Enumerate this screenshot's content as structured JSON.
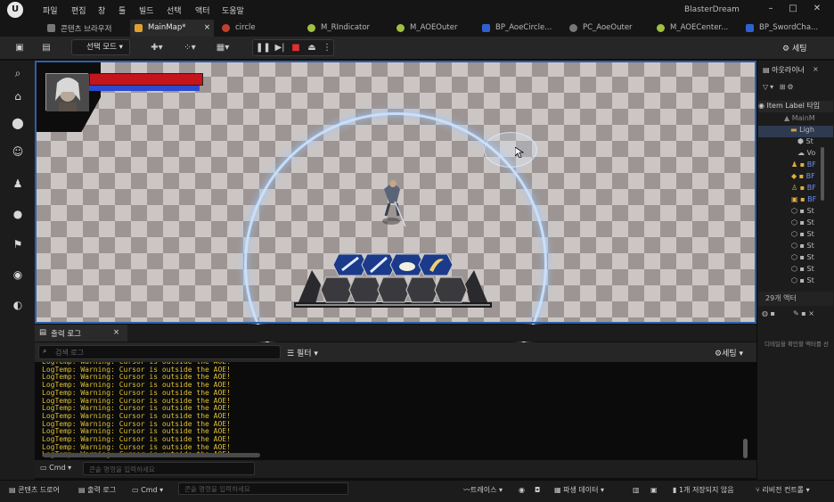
{
  "menu": {
    "logo": "U",
    "items": [
      "파일",
      "편집",
      "창",
      "툴",
      "빌드",
      "선택",
      "액터",
      "도움말"
    ]
  },
  "app_title": "BlasterDream",
  "window_controls": [
    "–",
    "□",
    "✕"
  ],
  "tabs": [
    {
      "label": "콘텐츠 브라우저"
    },
    {
      "label": "MainMap*"
    },
    {
      "label": "circle"
    },
    {
      "label": "M_RIndicator"
    },
    {
      "label": "M_AOEOuter"
    },
    {
      "label": "BP_AoeCircle..."
    },
    {
      "label": "PC_AoeOuter"
    },
    {
      "label": "M_AOECenter..."
    },
    {
      "label": "BP_SwordCha..."
    }
  ],
  "toolbar": {
    "mode_label": "선택 모드",
    "settings_label": "세팅"
  },
  "outliner": {
    "title": "아웃라이너",
    "header_label": "Item Label",
    "header_type": "타입",
    "rows": [
      "MainM",
      "Ligh",
      "St",
      "Vo",
      "BF",
      "BF",
      "BF",
      "BF",
      "St",
      "St",
      "St",
      "St",
      "St",
      "St",
      "St"
    ],
    "actor_count": "29개 액터",
    "details_hint": "디테일을 확인할 액터를 선"
  },
  "output_log": {
    "tab_label": "출력 로그",
    "search_placeholder": "검색 로그",
    "filter_label": "필터",
    "settings_label": "세팅",
    "line_text": "LogTemp: Warning: Cursor is outside the AOE!",
    "line_count": 13,
    "cmd_label": "Cmd",
    "cmd_placeholder": "콘솔 명령을 입력하세요"
  },
  "statusbar": {
    "content_drawer": "콘텐츠 드로어",
    "output_log": "출력 로그",
    "cmd_label": "Cmd",
    "cmd_placeholder": "콘솔 명령을 입력하세요",
    "trace": "트레이스",
    "derived_data": "파생 데이터",
    "unsaved": "1개 저장되지 않음",
    "revision": "리비전 컨트롤"
  },
  "game_hud": {
    "health_fraction": 1.0,
    "mana_fraction": 0.97,
    "skill_slots": 4,
    "empty_slots": 5
  }
}
